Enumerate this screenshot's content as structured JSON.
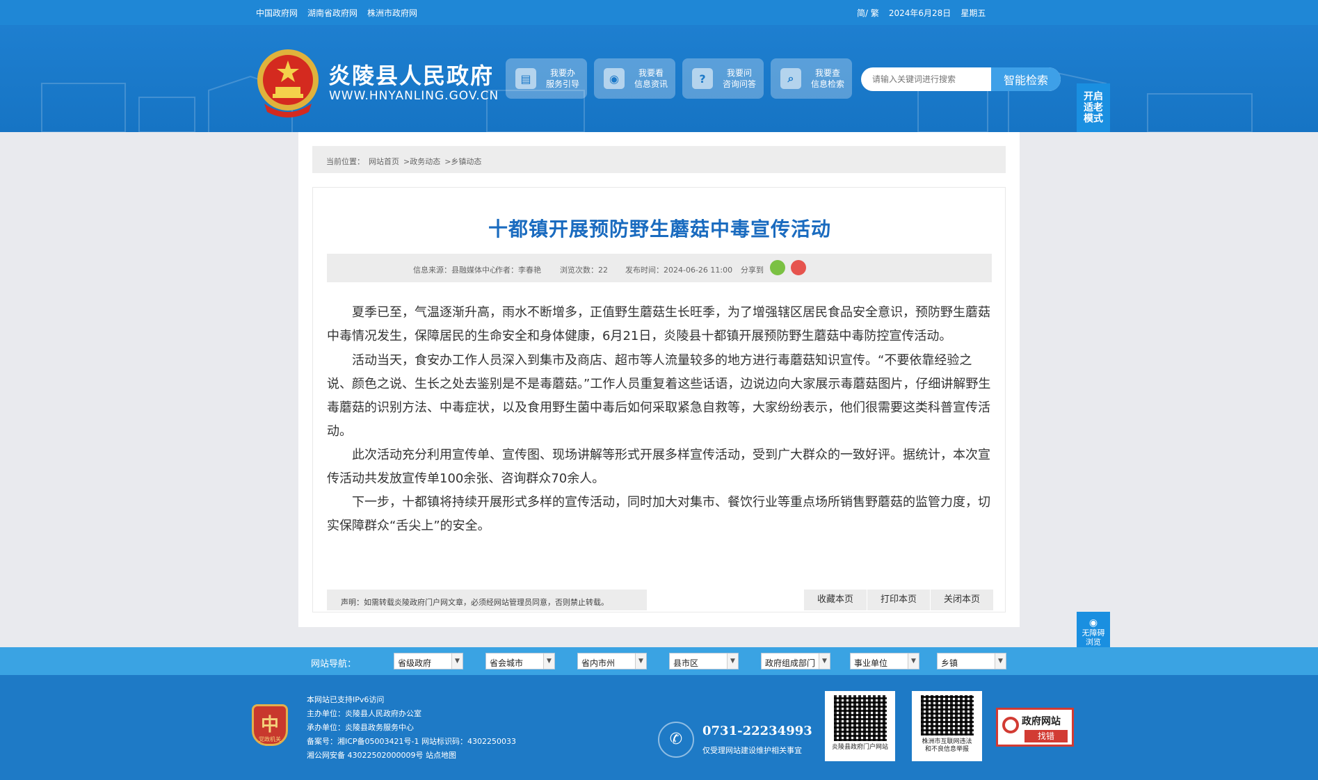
{
  "topbar": {
    "links": [
      "中国政府网",
      "湖南省政府网",
      "株洲市政府网"
    ],
    "lang_switch": "简/ 繁",
    "date": "2024年6月28日",
    "weekday": "星期五"
  },
  "header": {
    "title": "炎陵县人民政府",
    "domain": "WWW.HNYANLING.GOV.CN",
    "nav": [
      {
        "line1": "我要办",
        "line2": "服务引导",
        "icon": "document-icon"
      },
      {
        "line1": "我要看",
        "line2": "信息资讯",
        "icon": "eye-icon"
      },
      {
        "line1": "我要问",
        "line2": "咨询问答",
        "icon": "question-icon"
      },
      {
        "line1": "我要查",
        "line2": "信息检索",
        "icon": "search-icon"
      }
    ],
    "search_placeholder": "请输入关键词进行搜索",
    "search_button": "智能检索",
    "elder_mode": [
      "开启",
      "适老",
      "模式"
    ]
  },
  "breadcrumb": {
    "label": "当前位置：",
    "items": [
      "网站首页",
      ">政务动态",
      ">乡镇动态"
    ]
  },
  "article": {
    "title": "十都镇开展预防野生蘑菇中毒宣传活动",
    "source": "信息来源：县融媒体中心",
    "author": "作者：李春艳",
    "views": "浏览次数：22",
    "publish_time": "发布时间：2024-06-26 11:00",
    "share": "分享到",
    "paragraphs": [
      "夏季已至，气温逐渐升高，雨水不断增多，正值野生蘑菇生长旺季，为了增强辖区居民食品安全意识，预防野生蘑菇中毒情况发生，保障居民的生命安全和身体健康，6月21日，炎陵县十都镇开展预防野生蘑菇中毒防控宣传活动。",
      "活动当天，食安办工作人员深入到集市及商店、超市等人流量较多的地方进行毒蘑菇知识宣传。“不要依靠经验之说、颜色之说、生长之处去鉴别是不是毒蘑菇。”工作人员重复着这些话语，边说边向大家展示毒蘑菇图片，仔细讲解野生毒蘑菇的识别方法、中毒症状，以及食用野生菌中毒后如何采取紧急自救等，大家纷纷表示，他们很需要这类科普宣传活动。",
      "此次活动充分利用宣传单、宣传图、现场讲解等形式开展多样宣传活动，受到广大群众的一致好评。据统计，本次宣传活动共发放宣传单100余张、咨询群众70余人。",
      "下一步，十都镇将持续开展形式多样的宣传活动，同时加大对集市、餐饮行业等重点场所销售野蘑菇的监管力度，切实保障群众“舌尖上”的安全。"
    ],
    "notice": "声明：如需转载炎陵政府门户网文章，必须经网站管理员同意，否则禁止转载。",
    "actions": [
      "收藏本页",
      "打印本页",
      "关闭本页"
    ]
  },
  "accessibility": [
    "无障碍",
    "浏览"
  ],
  "site_nav": {
    "label": "网站导航：",
    "selects": [
      "省级政府",
      "省会城市",
      "省内市州",
      "县市区",
      "政府组成部门",
      "事业单位",
      "乡镇"
    ]
  },
  "footer": {
    "badge": "党政机关",
    "info": [
      "本网站已支持IPv6访问",
      "主办单位：炎陵县人民政府办公室",
      "承办单位：炎陵县政务服务中心",
      "备案号：湘ICP备05003421号-1 网站标识码：4302250033",
      "湘公网安备 43022502000009号 站点地图"
    ],
    "phone": "0731-22234993",
    "phone_note": "仅受理网站建设维护相关事宜",
    "qr1_caption": "炎陵县政府门户网站",
    "qr2_caption": [
      "株洲市互联网违法",
      "和不良信息举报"
    ],
    "jiucuo": {
      "line1": "政府网站",
      "line2": "找错"
    }
  },
  "colors": {
    "header_blue": "#1674c4",
    "title_blue": "#1a6bbf",
    "nav_bar": "#3aa3e3",
    "footer_blue": "#1e7ac6"
  }
}
